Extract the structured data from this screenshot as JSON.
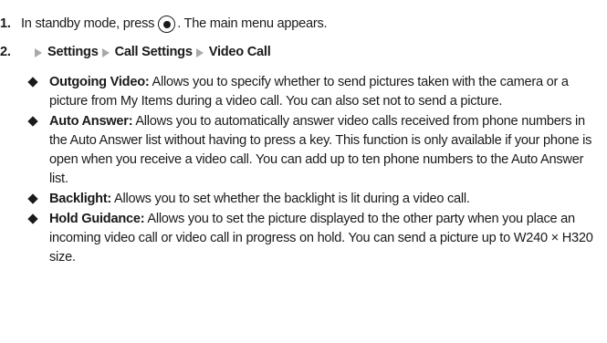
{
  "steps": [
    {
      "number": "1.",
      "before_icon": "In standby mode, press",
      "icon": "center-select-key-icon",
      "after_icon": ". The main menu appears."
    },
    {
      "number": "2.",
      "path": [
        "Settings",
        "Call Settings",
        "Video Call"
      ]
    }
  ],
  "items": [
    {
      "term": "Outgoing Video:",
      "description": "Allows you to specify whether to send pictures taken with the camera or a picture from My Items during a video call. You can also set not to send a picture."
    },
    {
      "term": "Auto Answer:",
      "description": "Allows you to automatically answer video calls received from phone numbers in the Auto Answer list without having to press a key. This function is only available if your phone is open when you receive a video call. You can add up to ten phone numbers to the Auto Answer list."
    },
    {
      "term": "Backlight:",
      "description": "Allows you to set whether the backlight is lit during a video call."
    },
    {
      "term": "Hold Guidance:",
      "description": "Allows you to set the picture displayed to the other party when you place an incoming video call or video call in progress on hold. You can send a picture up to W240 × H320 size."
    }
  ]
}
